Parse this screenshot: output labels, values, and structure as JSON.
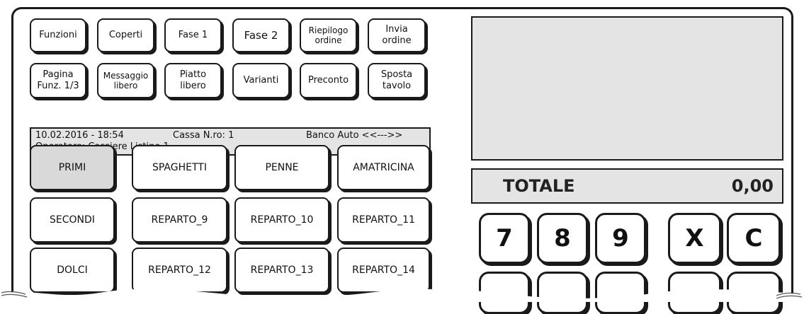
{
  "function_buttons": [
    {
      "label": "Funzioni"
    },
    {
      "label": "Coperti"
    },
    {
      "label": "Fase 1"
    },
    {
      "label": "Fase 2"
    },
    {
      "label": "Riepilogo\nordine"
    },
    {
      "label": "Invia\nordine"
    },
    {
      "label": "Pagina\nFunz. 1/3"
    },
    {
      "label": "Messaggio\nlibero"
    },
    {
      "label": "Piatto\nlibero"
    },
    {
      "label": "Varianti"
    },
    {
      "label": "Preconto"
    },
    {
      "label": "Sposta\ntavolo"
    }
  ],
  "status_bar": {
    "datetime": "10.02.2016 - 18:54",
    "register": "Cassa N.ro: 1",
    "mode": "Banco Auto <<--->>",
    "operator": "Operatore: Cassiere  Listino 1"
  },
  "categories": [
    {
      "label": "PRIMI",
      "active": true
    },
    {
      "label": "SPAGHETTI"
    },
    {
      "label": "PENNE"
    },
    {
      "label": "AMATRICINA"
    },
    {
      "label": "SECONDI"
    },
    {
      "label": "REPARTO_9"
    },
    {
      "label": "REPARTO_10"
    },
    {
      "label": "REPARTO_11"
    },
    {
      "label": "DOLCI"
    },
    {
      "label": "REPARTO_12"
    },
    {
      "label": "REPARTO_13"
    },
    {
      "label": "REPARTO_14"
    }
  ],
  "total": {
    "label": "TOTALE",
    "value": "0,00"
  },
  "keypad": [
    "7",
    "8",
    "9",
    "X",
    "C"
  ]
}
